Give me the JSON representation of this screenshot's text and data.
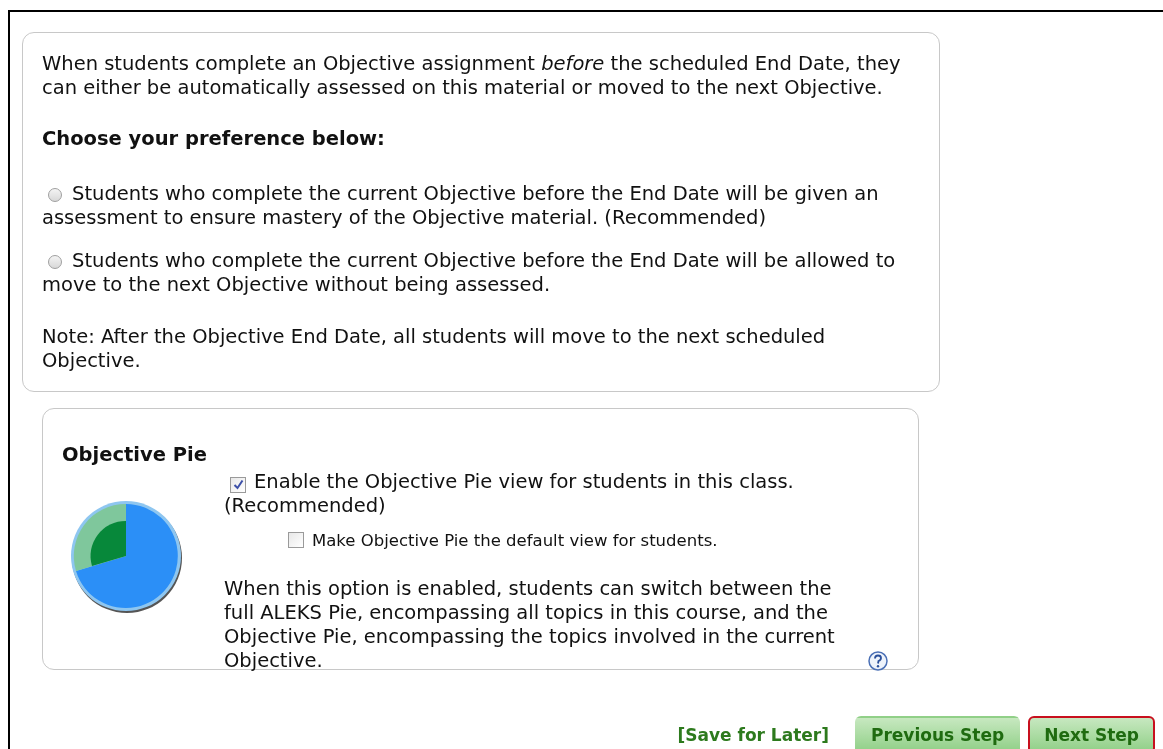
{
  "preference_panel": {
    "intro": "When students complete an Objective assignment *before* the scheduled End Date, they can either be automatically assessed on this material or moved to the next Objective.",
    "heading": "Choose your preference below:",
    "options": [
      {
        "label": "Students who complete the current Objective before the End Date will be given an assessment to ensure mastery of the Objective material. (Recommended)",
        "selected": false
      },
      {
        "label": "Students who complete the current Objective before the End Date will be allowed to move to the next Objective without being assessed.",
        "selected": false
      }
    ],
    "note": "Note: After the Objective End Date, all students will move to the next scheduled Objective."
  },
  "pie_panel": {
    "title": "Objective Pie",
    "enable_option": {
      "label": "Enable the Objective Pie view for students in this class. (Recommended)",
      "checked": true
    },
    "default_option": {
      "label": "Make Objective Pie the default view for students.",
      "checked": false
    },
    "description": "When this option is enabled, students can switch between the full ALEKS Pie, encompassing all topics in this course, and the Objective Pie, encompassing the topics involved in the current Objective."
  },
  "footer": {
    "save_link": "[Save for Later]",
    "buttons": [
      {
        "label": "Previous Step",
        "highlighted": false
      },
      {
        "label": "Next Step",
        "highlighted": true
      }
    ]
  }
}
